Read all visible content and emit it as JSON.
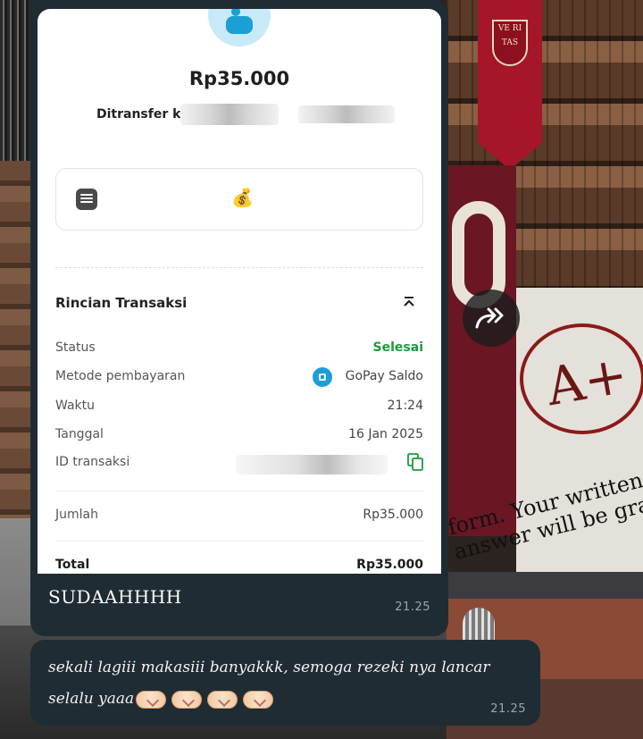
{
  "receipt": {
    "amount": "Rp35.000",
    "transfer_label": "Ditransfer ke",
    "note_emoji": "💰",
    "section_title": "Rincian Transaksi",
    "rows": {
      "status": {
        "label": "Status",
        "value": "Selesai"
      },
      "method": {
        "label": "Metode pembayaran",
        "value": "GoPay Saldo"
      },
      "time": {
        "label": "Waktu",
        "value": "21:24"
      },
      "date": {
        "label": "Tanggal",
        "value": "16 Jan 2025"
      },
      "id": {
        "label": "ID transaksi"
      },
      "amount": {
        "label": "Jumlah",
        "value": "Rp35.000"
      },
      "total": {
        "label": "Total",
        "value": "Rp35.000"
      }
    },
    "colors": {
      "status_green": "#1a9b3a",
      "gopay_blue": "#1b9fd6"
    }
  },
  "messages": [
    {
      "text": "SUDAAHHHH",
      "time": "21.25"
    },
    {
      "text": "sekali lagiii makasiii banyakkk, semoga rezeki nya lancar selalu yaaa",
      "emoji_count": 4,
      "time": "21.25"
    }
  ],
  "icons": {
    "forward": "forward-icon",
    "note": "note-icon",
    "copy": "copy-icon",
    "collapse": "chevron-up-icon",
    "gopay": "gopay-wallet-icon",
    "heart": "heart-hands-emoji"
  },
  "colors": {
    "bubble": "#1f2c34",
    "timestamp": "#9aa6ad",
    "message_text": "#f1f1f1"
  }
}
